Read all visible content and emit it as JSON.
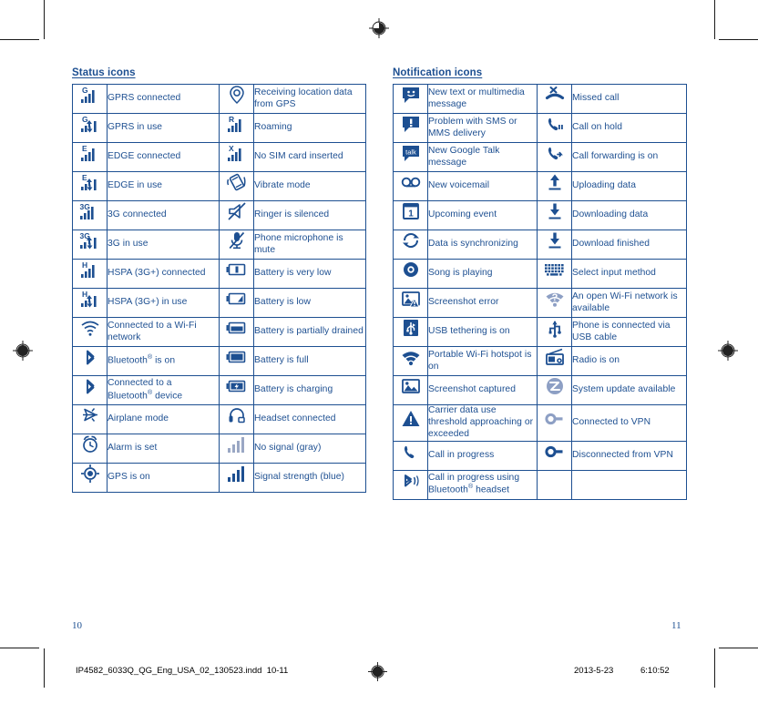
{
  "document": {
    "left_page_number": "10",
    "right_page_number": "11",
    "print_file": "IP4582_6033Q_QG_Eng_USA_02_130523.indd",
    "print_pages": "10-11",
    "print_date": "2013-5-23",
    "print_time": "6:10:52",
    "accent_color": "#1d4f91",
    "muted_icon_color": "#8d9fc4"
  },
  "status_icons": {
    "title": "Status icons",
    "rows": [
      {
        "left": {
          "icon": "signal-gprs-connected-icon",
          "label": "GPRS connected"
        },
        "right": {
          "icon": "gps-location-pin-icon",
          "label": "Receiving location data from GPS"
        }
      },
      {
        "left": {
          "icon": "signal-gprs-in-use-icon",
          "label": "GPRS in use"
        },
        "right": {
          "icon": "signal-roaming-icon",
          "label": "Roaming"
        }
      },
      {
        "left": {
          "icon": "signal-edge-connected-icon",
          "label": "EDGE connected"
        },
        "right": {
          "icon": "signal-no-sim-icon",
          "label": "No SIM card inserted"
        }
      },
      {
        "left": {
          "icon": "signal-edge-in-use-icon",
          "label": "EDGE in use"
        },
        "right": {
          "icon": "vibrate-mode-icon",
          "label": "Vibrate mode"
        }
      },
      {
        "left": {
          "icon": "signal-3g-connected-icon",
          "label": "3G connected"
        },
        "right": {
          "icon": "ringer-silenced-icon",
          "label": "Ringer is silenced"
        }
      },
      {
        "left": {
          "icon": "signal-3g-in-use-icon",
          "label": "3G in use"
        },
        "right": {
          "icon": "microphone-mute-icon",
          "label": "Phone microphone is mute"
        }
      },
      {
        "left": {
          "icon": "signal-hspa-connected-icon",
          "label": "HSPA (3G+) connected"
        },
        "right": {
          "icon": "battery-very-low-icon",
          "label": "Battery is very low"
        }
      },
      {
        "left": {
          "icon": "signal-hspa-in-use-icon",
          "label": "HSPA (3G+) in use"
        },
        "right": {
          "icon": "battery-low-icon",
          "label": "Battery is low"
        }
      },
      {
        "left": {
          "icon": "wifi-connected-icon",
          "label": "Connected to a Wi-Fi network"
        },
        "right": {
          "icon": "battery-partially-drained-icon",
          "label": "Battery is partially drained"
        }
      },
      {
        "left": {
          "icon": "bluetooth-on-icon",
          "label": "Bluetooth® is on"
        },
        "right": {
          "icon": "battery-full-icon",
          "label": "Battery is full"
        }
      },
      {
        "left": {
          "icon": "bluetooth-device-connected-icon",
          "label": "Connected to a Bluetooth® device"
        },
        "right": {
          "icon": "battery-charging-icon",
          "label": "Battery is charging"
        }
      },
      {
        "left": {
          "icon": "airplane-mode-icon",
          "label": "Airplane mode"
        },
        "right": {
          "icon": "headset-connected-icon",
          "label": "Headset connected"
        }
      },
      {
        "left": {
          "icon": "alarm-clock-icon",
          "label": "Alarm is set"
        },
        "right": {
          "icon": "signal-no-signal-gray-icon",
          "label": "No signal (gray)"
        }
      },
      {
        "left": {
          "icon": "gps-on-icon",
          "label": "GPS is on"
        },
        "right": {
          "icon": "signal-strength-blue-icon",
          "label": "Signal strength (blue)"
        }
      }
    ]
  },
  "notification_icons": {
    "title": "Notification icons",
    "rows": [
      {
        "left": {
          "icon": "new-message-icon",
          "label": "New text or multimedia message"
        },
        "right": {
          "icon": "missed-call-icon",
          "label": "Missed call"
        }
      },
      {
        "left": {
          "icon": "message-problem-icon",
          "label": "Problem with SMS or MMS delivery"
        },
        "right": {
          "icon": "call-on-hold-icon",
          "label": "Call on hold"
        }
      },
      {
        "left": {
          "icon": "google-talk-message-icon",
          "label": "New Google Talk message"
        },
        "right": {
          "icon": "call-forwarding-icon",
          "label": "Call forwarding is on"
        }
      },
      {
        "left": {
          "icon": "voicemail-icon",
          "label": "New voicemail"
        },
        "right": {
          "icon": "upload-data-icon",
          "label": "Uploading data"
        }
      },
      {
        "left": {
          "icon": "upcoming-event-icon",
          "label": "Upcoming event"
        },
        "right": {
          "icon": "download-data-icon",
          "label": "Downloading data"
        }
      },
      {
        "left": {
          "icon": "data-sync-icon",
          "label": "Data is synchronizing"
        },
        "right": {
          "icon": "download-finished-icon",
          "label": "Download finished"
        }
      },
      {
        "left": {
          "icon": "song-playing-icon",
          "label": "Song is playing"
        },
        "right": {
          "icon": "select-input-method-icon",
          "label": "Select input method"
        }
      },
      {
        "left": {
          "icon": "screenshot-error-icon",
          "label": "Screenshot error"
        },
        "right": {
          "icon": "open-wifi-available-icon",
          "label": "An open Wi-Fi network is available"
        }
      },
      {
        "left": {
          "icon": "usb-tethering-icon",
          "label": "USB tethering is on"
        },
        "right": {
          "icon": "usb-connected-icon",
          "label": "Phone is connected via USB cable"
        }
      },
      {
        "left": {
          "icon": "portable-wifi-hotspot-icon",
          "label": "Portable Wi-Fi hotspot is on"
        },
        "right": {
          "icon": "radio-on-icon",
          "label": "Radio is on"
        }
      },
      {
        "left": {
          "icon": "screenshot-captured-icon",
          "label": "Screenshot captured"
        },
        "right": {
          "icon": "system-update-icon",
          "label": "System update available"
        }
      },
      {
        "left": {
          "icon": "carrier-data-warning-icon",
          "label": "Carrier data use threshold approaching or exceeded"
        },
        "right": {
          "icon": "vpn-connected-icon",
          "label": "Connected to VPN"
        }
      },
      {
        "left": {
          "icon": "call-in-progress-icon",
          "label": "Call in progress"
        },
        "right": {
          "icon": "vpn-disconnected-icon",
          "label": "Disconnected from VPN"
        }
      },
      {
        "left": {
          "icon": "call-bluetooth-headset-icon",
          "label": "Call in progress using Bluetooth® headset"
        },
        "right": {
          "icon": "",
          "label": ""
        }
      }
    ]
  }
}
